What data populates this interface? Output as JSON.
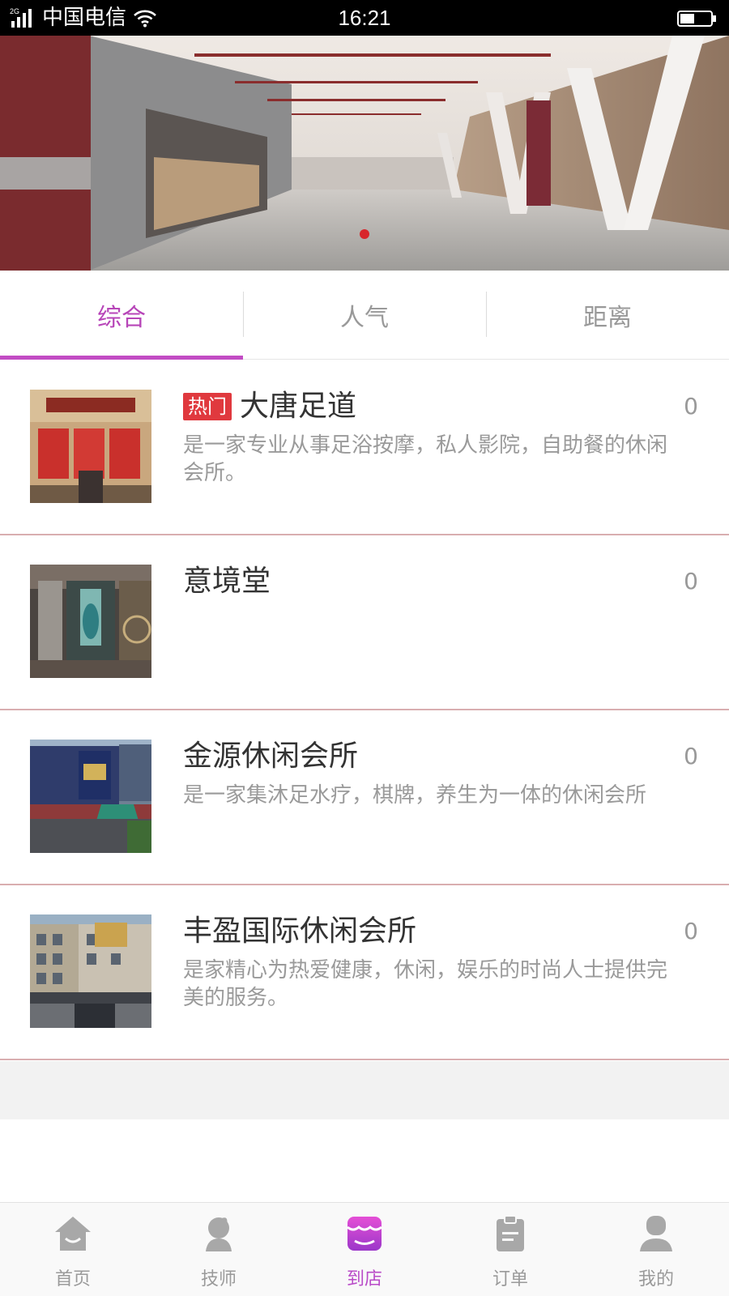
{
  "status_bar": {
    "network": "2G",
    "carrier": "中国电信",
    "time": "16:21"
  },
  "banner": {
    "slide_count": 1,
    "active_slide": 1,
    "indicator_color": "#d8262b"
  },
  "tabs": [
    {
      "label": "综合",
      "active": true
    },
    {
      "label": "人气",
      "active": false
    },
    {
      "label": "距离",
      "active": false
    }
  ],
  "stores": [
    {
      "badge": "热门",
      "name": "大唐足道",
      "description": "是一家专业从事足浴按摩，私人影院，自助餐的休闲会所。",
      "count": "0"
    },
    {
      "badge": "",
      "name": "意境堂",
      "description": "",
      "count": "0"
    },
    {
      "badge": "",
      "name": "金源休闲会所",
      "description": "是一家集沐足水疗，棋牌，养生为一体的休闲会所",
      "count": "0"
    },
    {
      "badge": "",
      "name": "丰盈国际休闲会所",
      "description": "是家精心为热爱健康，休闲，娱乐的时尚人士提供完美的服务。",
      "count": "0"
    }
  ],
  "bottom_nav": [
    {
      "label": "首页",
      "icon": "home-icon",
      "active": false
    },
    {
      "label": "技师",
      "icon": "technician-icon",
      "active": false
    },
    {
      "label": "到店",
      "icon": "store-icon",
      "active": true
    },
    {
      "label": "订单",
      "icon": "order-clipboard-icon",
      "active": false
    },
    {
      "label": "我的",
      "icon": "profile-icon",
      "active": false
    }
  ],
  "colors": {
    "accent": "#b745b8",
    "badge": "#e0393e",
    "divider": "#d9aeb0",
    "inactive": "#9a9a9a"
  }
}
